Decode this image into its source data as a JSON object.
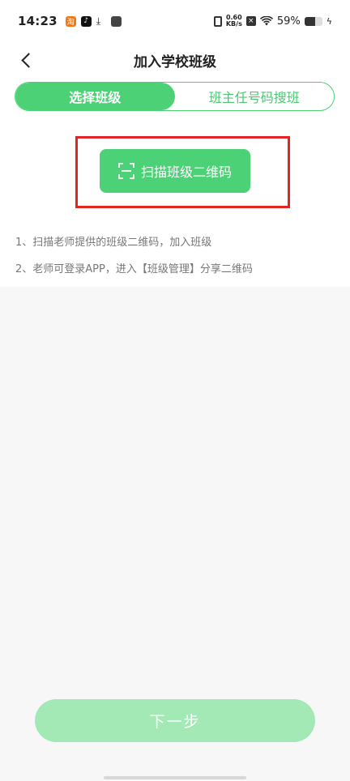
{
  "status_bar": {
    "time": "14:23",
    "taobao_icon_glyph": "淘",
    "tiktok_icon_glyph": "♪",
    "download_icon_glyph": "⤓",
    "net_speed_value": "0.60",
    "net_speed_unit": "KB/s",
    "battery_percent": "59%",
    "battery_level": 0.59
  },
  "header": {
    "title": "加入学校班级"
  },
  "tabs": [
    {
      "label": "选择班级",
      "active": true
    },
    {
      "label": "班主任号码搜班",
      "active": false
    }
  ],
  "scan_button": {
    "label": "扫描班级二维码"
  },
  "instructions": [
    "1、扫描老师提供的班级二维码，加入班级",
    "2、老师可登录APP，进入【班级管理】分享二维码"
  ],
  "next_button": {
    "label": "下一步"
  },
  "colors": {
    "accent": "#4dd176",
    "accent_disabled": "#a3e9b6",
    "highlight": "#e32424"
  }
}
